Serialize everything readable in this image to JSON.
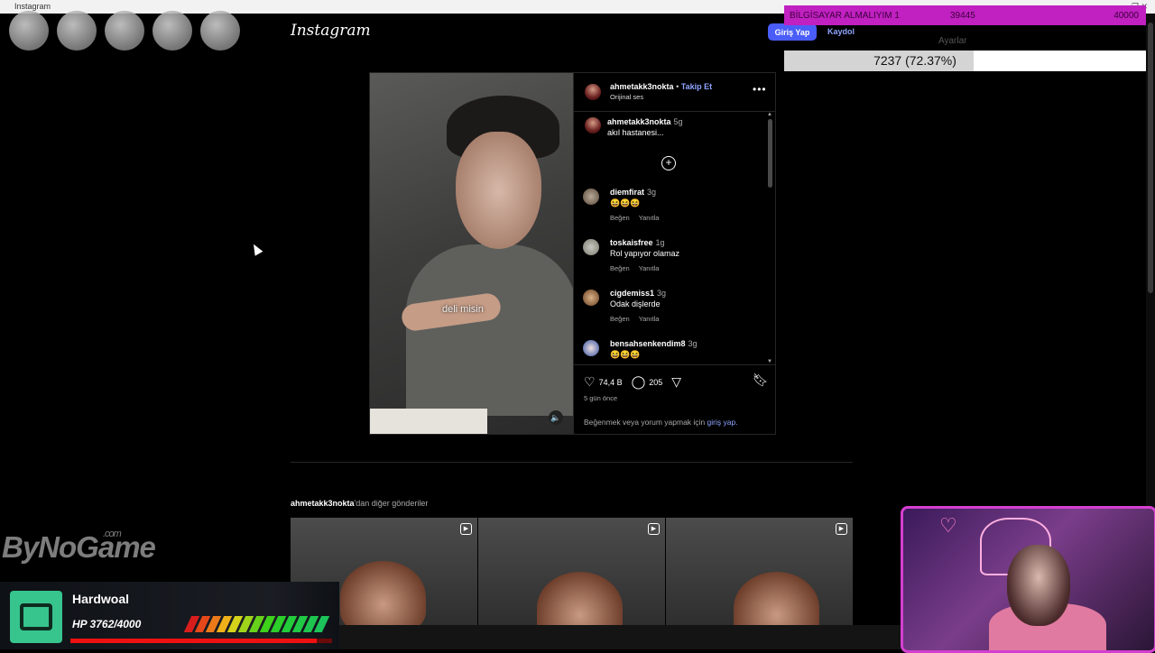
{
  "window": {
    "title": "Instagram",
    "controls": "— ❐ ✕"
  },
  "header": {
    "logo": "Instagram",
    "login_label": "Giriş Yap",
    "signup_label": "Kaydol"
  },
  "overlay": {
    "goal": {
      "label": "BİLGİSAYAR ALMALIYIM 1",
      "current": "39445",
      "target": "40000"
    },
    "progress": {
      "text": "7237 (72.37%)",
      "fraction": 0.7237,
      "faint_label": "Ayarlar"
    },
    "watermark": {
      "brand": "ByNoGame",
      "suffix": ".com"
    },
    "hp": {
      "name": "Hardwoal",
      "value": "HP 3762/4000",
      "fraction": 0.9405
    }
  },
  "post": {
    "author": "ahmetakk3nokta",
    "separator": "•",
    "follow_label": "Takip Et",
    "audio": "Orijinal ses",
    "video_caption": "deli misin",
    "likes": "74,4 B",
    "comment_count": "205",
    "time_ago": "5 gün önce",
    "login_prompt": "Beğenmek veya yorum yapmak için",
    "login_link": "giriş yap."
  },
  "comments": [
    {
      "user": "ahmetakk3nokta",
      "time": "5g",
      "text": "akıl hastanesi...",
      "like": "",
      "reply": ""
    },
    {
      "user": "diemfirat",
      "time": "3g",
      "text": "😆😆😆",
      "like": "Beğen",
      "reply": "Yanıtla"
    },
    {
      "user": "toskaisfree",
      "time": "1g",
      "text": "Rol yapıyor olamaz",
      "like": "Beğen",
      "reply": "Yanıtla"
    },
    {
      "user": "cigdemiss1",
      "time": "3g",
      "text": "Odak dişlerde",
      "like": "Beğen",
      "reply": "Yanıtla"
    },
    {
      "user": "bensahsenkendim8",
      "time": "3g",
      "text": "😆😆😆",
      "like": "",
      "reply": ""
    }
  ],
  "more_posts": {
    "user": "ahmetakk3nokta",
    "suffix": "'dan diğer gönderiler"
  },
  "colors": {
    "accent": "#4a5df9",
    "link": "#8ea4ff",
    "goal_bar": "#c021c0",
    "hp_bar": "#ee1111",
    "webcam_border": "#d43fd0"
  }
}
